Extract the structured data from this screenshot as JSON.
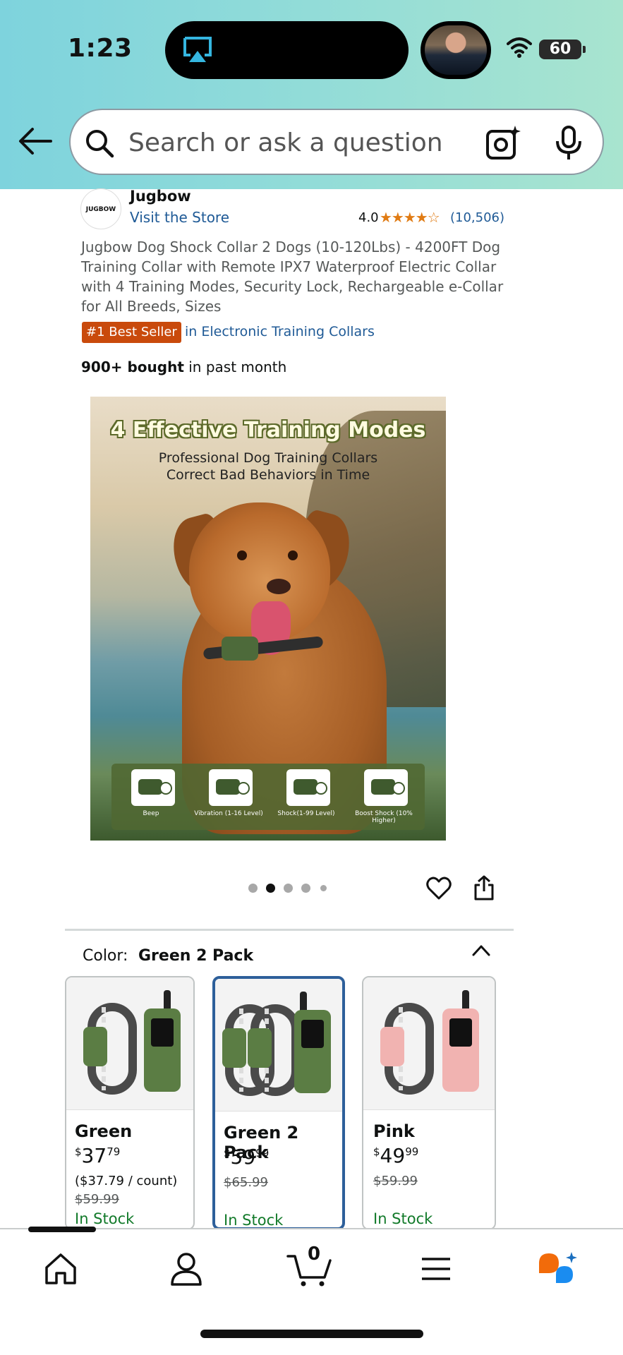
{
  "status_bar": {
    "time": "1:23",
    "battery": "60"
  },
  "header": {
    "search_placeholder": "Search or ask a question"
  },
  "product": {
    "brand_logo_text": "JUGBOW",
    "brand_name": "Jugbow",
    "visit_store": "Visit the Store",
    "rating": "4.0",
    "stars": "★★★★☆",
    "rating_count": "(10,506)",
    "title": "Jugbow Dog Shock Collar 2 Dogs (10-120Lbs) - 4200FT Dog Training Collar with Remote IPX7 Waterproof Electric Collar with 4 Training Modes, Security Lock, Rechargeable e-Collar for All Breeds, Sizes",
    "badge": "#1 Best Seller",
    "badge_category": "in Electronic Training Collars",
    "bought_bold": "900+ bought",
    "bought_rest": " in past month"
  },
  "image": {
    "heading": "4 Effective Training Modes",
    "sub1": "Professional Dog Training Collars",
    "sub2": "Correct Bad Behaviors in Time",
    "modes": [
      {
        "label": "Beep"
      },
      {
        "label": "Vibration (1-16 Level)"
      },
      {
        "label": "Shock(1-99 Level)"
      },
      {
        "label": "Boost Shock (10% Higher)"
      }
    ],
    "carousel_active_index": 1,
    "carousel_count": 5
  },
  "variation": {
    "color_label": "Color:",
    "color_value": "Green 2 Pack",
    "swatches": [
      {
        "name": "Green",
        "price_dollars": "37",
        "price_cents": "79",
        "unit": "($37.79 / count)",
        "list_price": "$59.99",
        "stock": "In Stock",
        "color": "#5b7d44"
      },
      {
        "name": "Green 2 Pack",
        "price_dollars": "59",
        "price_cents": "99",
        "list_price": "$65.99",
        "stock": "In Stock",
        "color": "#5b7d44"
      },
      {
        "name": "Pink",
        "price_dollars": "49",
        "price_cents": "99",
        "list_price": "$59.99",
        "stock": "In Stock",
        "color": "#f1b3b1"
      }
    ],
    "currency_symbol": "$"
  },
  "bottom_nav": {
    "cart_count": "0",
    "items": [
      "home-icon",
      "account-icon",
      "cart-icon",
      "menu-icon",
      "rufus-icon"
    ]
  },
  "colors": {
    "header_gradient_start": "#7ed3dd",
    "header_gradient_end": "#a8e4cf",
    "link": "#1f5a96",
    "stars": "#e07b14",
    "best_seller": "#c94a0c",
    "in_stock": "#127a2a",
    "selected_border": "#2d5f9a"
  }
}
